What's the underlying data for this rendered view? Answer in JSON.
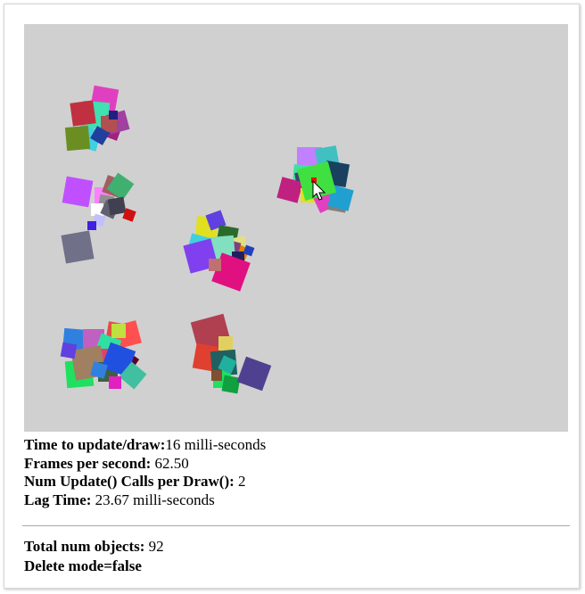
{
  "stats": {
    "update_draw_label": "Time to update/draw:",
    "update_draw_value": "16 milli-seconds",
    "fps_label": "Frames per second:",
    "fps_value": " 62.50",
    "calls_label": "Num Update() Calls per Draw():",
    "calls_value": " 2",
    "lag_label": "Lag Time:",
    "lag_value": " 23.67 milli-seconds"
  },
  "summary": {
    "total_label": "Total num objects:",
    "total_value": " 92",
    "delete_mode_text": "Delete mode=false"
  },
  "colors": {
    "canvas_bg": "#d0d0d0",
    "cursor_marker": "#ff0000"
  }
}
